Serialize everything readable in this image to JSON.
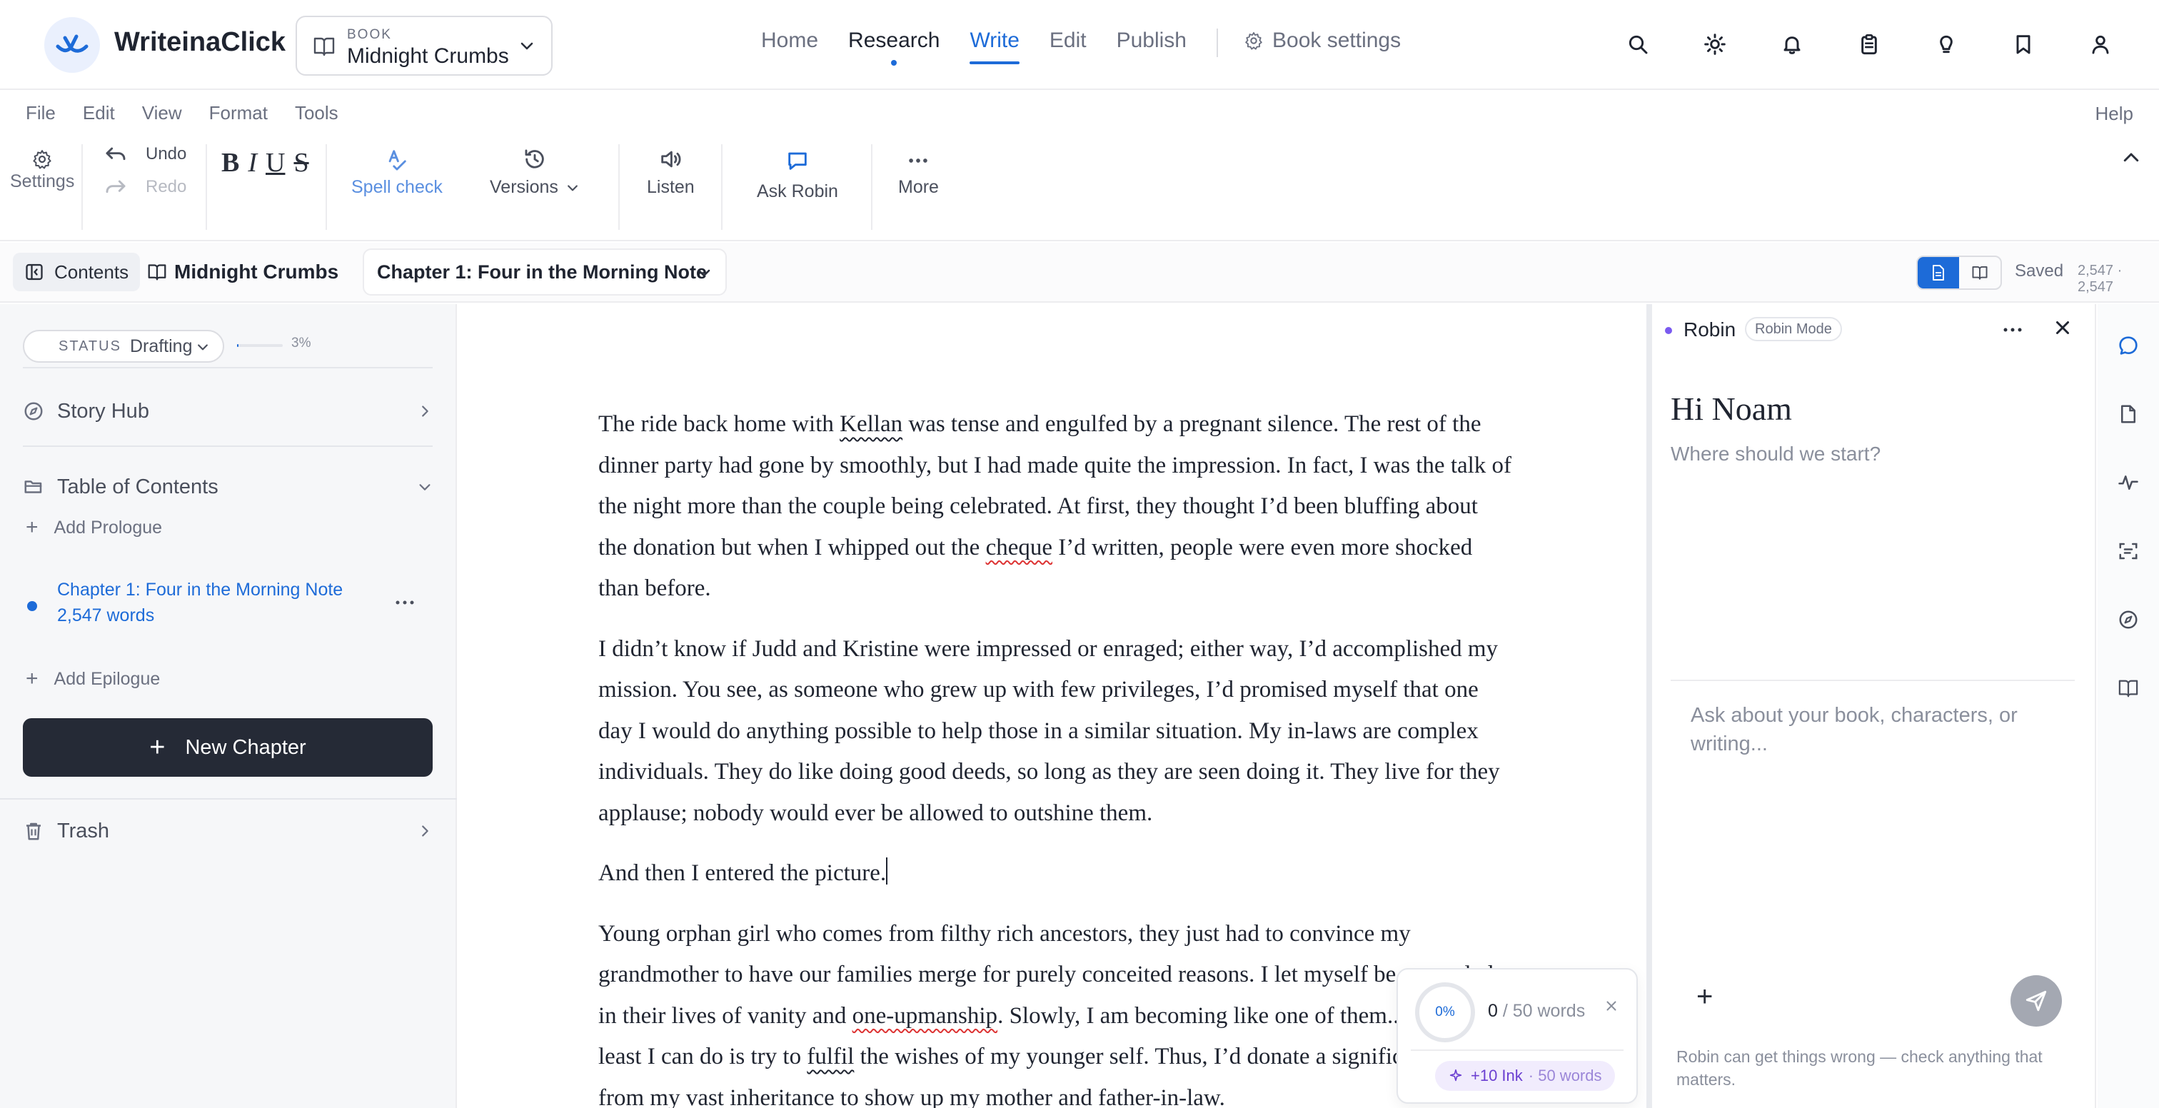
{
  "app": {
    "name": "WriteinaClick"
  },
  "book_picker": {
    "kicker": "BOOK",
    "title": "Midnight Crumbs"
  },
  "nav": {
    "items": [
      {
        "label": "Home"
      },
      {
        "label": "Research"
      },
      {
        "label": "Write"
      },
      {
        "label": "Edit"
      },
      {
        "label": "Publish"
      }
    ],
    "book_settings": "Book settings"
  },
  "top_icons": [
    "search-icon",
    "sun-icon",
    "bell-icon",
    "clipboard-icon",
    "lightbulb-icon",
    "bookmark-icon",
    "user-icon"
  ],
  "menu": {
    "items": [
      "File",
      "Edit",
      "View",
      "Format",
      "Tools"
    ],
    "help": "Help"
  },
  "toolbar": {
    "settings": "Settings",
    "undo": "Undo",
    "redo": "Redo",
    "format_letters": [
      "B",
      "I",
      "U",
      "S"
    ],
    "spell_check": "Spell check",
    "versions": "Versions",
    "listen": "Listen",
    "ask_robin": "Ask Robin",
    "more": "More"
  },
  "context": {
    "contents": "Contents",
    "book": "Midnight Crumbs",
    "chapter": "Chapter 1: Four in the Morning Note",
    "saved": "Saved",
    "counts": "2,547 · 2,547"
  },
  "sidebar": {
    "status_key": "STATUS",
    "status_value": "Drafting",
    "progress_pct": "3%",
    "progress_fraction": 0.03,
    "story_hub": "Story Hub",
    "toc": "Table of Contents",
    "add_prologue": "Add Prologue",
    "chapter_title": "Chapter 1: Four in the Morning Note",
    "chapter_words": "2,547 words",
    "add_epilogue": "Add Epilogue",
    "new_chapter": "New Chapter",
    "trash": "Trash"
  },
  "editor": {
    "p1": {
      "a": "The ride back home with ",
      "sq1": "Kellan",
      "b": " was tense and engulfed by a pregnant silence. The rest of the dinner party had gone by smoothly, but I had made quite the impression. In fact, I was the talk of the night more than the couple being celebrated. At first, they thought I’d been bluffing about the donation but when I whipped out the ",
      "sq2": "cheque",
      "c": " I’d written, people were even more shocked than before."
    },
    "p2": "I didn’t know if Judd and Kristine were impressed or enraged; either way, I’d accomplished my mission. You see, as someone who grew up with few privileges, I’d promised myself that one day I would do anything possible to help those in a similar situation. My in-laws are complex individuals. They do like doing good deeds, so long as they are seen doing it. They live for they applause; nobody would ever be allowed to outshine them.",
    "p3": "And then I entered the picture.",
    "p4": {
      "a": "Young orphan girl who comes from filthy rich ancestors, they just had to convince my grandmother to have our families merge for purely conceited reasons. I let myself be entangled in their lives of vanity and ",
      "sq1": "one-upmanship",
      "b": ". Slowly, I am becoming like one of them...but the least I can do is try to ",
      "sq2": "fulfil",
      "c": " the wishes of my younger self. Thus, I’d donate a significant amount from my vast inheritance to show up my mother and father-in-law."
    }
  },
  "goal": {
    "progress": "0%",
    "current": "0",
    "target": "/ 50 words",
    "reward": "+10 Ink",
    "reward_sub": "· 50 words"
  },
  "robin": {
    "name": "Robin",
    "mode": "Robin Mode",
    "greeting": "Hi Noam",
    "subtitle": "Where should we start?",
    "input_placeholder": "Ask about your book, characters, or writing...",
    "disclaimer": "Robin can get things wrong — check anything that matters."
  },
  "rail_icons": [
    "chat-icon",
    "document-icon",
    "activity-icon",
    "scan-text-icon",
    "compass-icon",
    "book-open-icon"
  ],
  "colors": {
    "accent": "#1d6bd8",
    "dark_button": "#252a36",
    "robin_purple": "#7a5af0",
    "spell_error": "#d33"
  }
}
